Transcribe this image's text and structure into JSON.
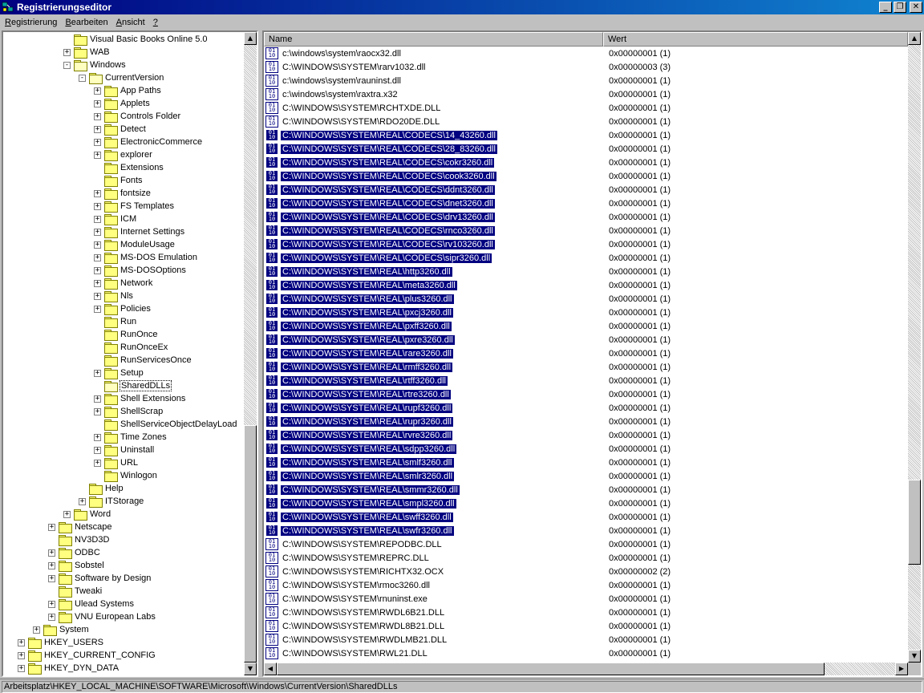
{
  "window": {
    "title": "Registrierungseditor",
    "minimize": "_",
    "maximize": "❐",
    "close": "✕",
    "app_icon": "registry-editor-icon"
  },
  "menu": [
    {
      "label": "Registrierung",
      "accel": "R"
    },
    {
      "label": "Bearbeiten",
      "accel": "B"
    },
    {
      "label": "Ansicht",
      "accel": "A"
    },
    {
      "label": "?",
      "accel": "?"
    }
  ],
  "tree": [
    {
      "label": "Visual Basic Books Online 5.0",
      "depth": 4,
      "expander": "",
      "open": false
    },
    {
      "label": "WAB",
      "depth": 4,
      "expander": "+",
      "open": false
    },
    {
      "label": "Windows",
      "depth": 4,
      "expander": "-",
      "open": true
    },
    {
      "label": "CurrentVersion",
      "depth": 5,
      "expander": "-",
      "open": true
    },
    {
      "label": "App Paths",
      "depth": 6,
      "expander": "+",
      "open": false
    },
    {
      "label": "Applets",
      "depth": 6,
      "expander": "+",
      "open": false
    },
    {
      "label": "Controls Folder",
      "depth": 6,
      "expander": "+",
      "open": false
    },
    {
      "label": "Detect",
      "depth": 6,
      "expander": "+",
      "open": false
    },
    {
      "label": "ElectronicCommerce",
      "depth": 6,
      "expander": "+",
      "open": false
    },
    {
      "label": "explorer",
      "depth": 6,
      "expander": "+",
      "open": false
    },
    {
      "label": "Extensions",
      "depth": 6,
      "expander": "",
      "open": false
    },
    {
      "label": "Fonts",
      "depth": 6,
      "expander": "",
      "open": false
    },
    {
      "label": "fontsize",
      "depth": 6,
      "expander": "+",
      "open": false
    },
    {
      "label": "FS Templates",
      "depth": 6,
      "expander": "+",
      "open": false
    },
    {
      "label": "ICM",
      "depth": 6,
      "expander": "+",
      "open": false
    },
    {
      "label": "Internet Settings",
      "depth": 6,
      "expander": "+",
      "open": false
    },
    {
      "label": "ModuleUsage",
      "depth": 6,
      "expander": "+",
      "open": false
    },
    {
      "label": "MS-DOS Emulation",
      "depth": 6,
      "expander": "+",
      "open": false
    },
    {
      "label": "MS-DOSOptions",
      "depth": 6,
      "expander": "+",
      "open": false
    },
    {
      "label": "Network",
      "depth": 6,
      "expander": "+",
      "open": false
    },
    {
      "label": "Nls",
      "depth": 6,
      "expander": "+",
      "open": false
    },
    {
      "label": "Policies",
      "depth": 6,
      "expander": "+",
      "open": false
    },
    {
      "label": "Run",
      "depth": 6,
      "expander": "",
      "open": false
    },
    {
      "label": "RunOnce",
      "depth": 6,
      "expander": "",
      "open": false
    },
    {
      "label": "RunOnceEx",
      "depth": 6,
      "expander": "",
      "open": false
    },
    {
      "label": "RunServicesOnce",
      "depth": 6,
      "expander": "",
      "open": false
    },
    {
      "label": "Setup",
      "depth": 6,
      "expander": "+",
      "open": false
    },
    {
      "label": "SharedDLLs",
      "depth": 6,
      "expander": "",
      "open": true,
      "selected": true
    },
    {
      "label": "Shell Extensions",
      "depth": 6,
      "expander": "+",
      "open": false
    },
    {
      "label": "ShellScrap",
      "depth": 6,
      "expander": "+",
      "open": false
    },
    {
      "label": "ShellServiceObjectDelayLoad",
      "depth": 6,
      "expander": "",
      "open": false
    },
    {
      "label": "Time Zones",
      "depth": 6,
      "expander": "+",
      "open": false
    },
    {
      "label": "Uninstall",
      "depth": 6,
      "expander": "+",
      "open": false
    },
    {
      "label": "URL",
      "depth": 6,
      "expander": "+",
      "open": false
    },
    {
      "label": "Winlogon",
      "depth": 6,
      "expander": "",
      "open": false
    },
    {
      "label": "Help",
      "depth": 5,
      "expander": "",
      "open": false
    },
    {
      "label": "ITStorage",
      "depth": 5,
      "expander": "+",
      "open": false
    },
    {
      "label": "Word",
      "depth": 4,
      "expander": "+",
      "open": false
    },
    {
      "label": "Netscape",
      "depth": 3,
      "expander": "+",
      "open": false
    },
    {
      "label": "NV3D3D",
      "depth": 3,
      "expander": "",
      "open": false
    },
    {
      "label": "ODBC",
      "depth": 3,
      "expander": "+",
      "open": false
    },
    {
      "label": "Sobstel",
      "depth": 3,
      "expander": "+",
      "open": false
    },
    {
      "label": "Software by Design",
      "depth": 3,
      "expander": "+",
      "open": false
    },
    {
      "label": "Tweaki",
      "depth": 3,
      "expander": "",
      "open": false
    },
    {
      "label": "Ulead Systems",
      "depth": 3,
      "expander": "+",
      "open": false
    },
    {
      "label": "VNU European Labs",
      "depth": 3,
      "expander": "+",
      "open": false
    },
    {
      "label": "System",
      "depth": 2,
      "expander": "+",
      "open": false
    },
    {
      "label": "HKEY_USERS",
      "depth": 1,
      "expander": "+",
      "open": false
    },
    {
      "label": "HKEY_CURRENT_CONFIG",
      "depth": 1,
      "expander": "+",
      "open": false
    },
    {
      "label": "HKEY_DYN_DATA",
      "depth": 1,
      "expander": "+",
      "open": false
    }
  ],
  "list": {
    "columns": [
      "Name",
      "Wert"
    ],
    "rows": [
      {
        "name": "c:\\windows\\system\\raocx32.dll",
        "value": "0x00000001 (1)",
        "selected": false
      },
      {
        "name": "C:\\WINDOWS\\SYSTEM\\rarv1032.dll",
        "value": "0x00000003 (3)",
        "selected": false
      },
      {
        "name": "c:\\windows\\system\\rauninst.dll",
        "value": "0x00000001 (1)",
        "selected": false
      },
      {
        "name": "c:\\windows\\system\\raxtra.x32",
        "value": "0x00000001 (1)",
        "selected": false
      },
      {
        "name": "C:\\WINDOWS\\SYSTEM\\RCHTXDE.DLL",
        "value": "0x00000001 (1)",
        "selected": false
      },
      {
        "name": "C:\\WINDOWS\\SYSTEM\\RDO20DE.DLL",
        "value": "0x00000001 (1)",
        "selected": false
      },
      {
        "name": "C:\\WINDOWS\\SYSTEM\\REAL\\CODECS\\14_43260.dll",
        "value": "0x00000001 (1)",
        "selected": true
      },
      {
        "name": "C:\\WINDOWS\\SYSTEM\\REAL\\CODECS\\28_83260.dll",
        "value": "0x00000001 (1)",
        "selected": true
      },
      {
        "name": "C:\\WINDOWS\\SYSTEM\\REAL\\CODECS\\cokr3260.dll",
        "value": "0x00000001 (1)",
        "selected": true
      },
      {
        "name": "C:\\WINDOWS\\SYSTEM\\REAL\\CODECS\\cook3260.dll",
        "value": "0x00000001 (1)",
        "selected": true
      },
      {
        "name": "C:\\WINDOWS\\SYSTEM\\REAL\\CODECS\\ddnt3260.dll",
        "value": "0x00000001 (1)",
        "selected": true
      },
      {
        "name": "C:\\WINDOWS\\SYSTEM\\REAL\\CODECS\\dnet3260.dll",
        "value": "0x00000001 (1)",
        "selected": true
      },
      {
        "name": "C:\\WINDOWS\\SYSTEM\\REAL\\CODECS\\drv13260.dll",
        "value": "0x00000001 (1)",
        "selected": true
      },
      {
        "name": "C:\\WINDOWS\\SYSTEM\\REAL\\CODECS\\rnco3260.dll",
        "value": "0x00000001 (1)",
        "selected": true
      },
      {
        "name": "C:\\WINDOWS\\SYSTEM\\REAL\\CODECS\\rv103260.dll",
        "value": "0x00000001 (1)",
        "selected": true
      },
      {
        "name": "C:\\WINDOWS\\SYSTEM\\REAL\\CODECS\\sipr3260.dll",
        "value": "0x00000001 (1)",
        "selected": true
      },
      {
        "name": "C:\\WINDOWS\\SYSTEM\\REAL\\http3260.dll",
        "value": "0x00000001 (1)",
        "selected": true
      },
      {
        "name": "C:\\WINDOWS\\SYSTEM\\REAL\\meta3260.dll",
        "value": "0x00000001 (1)",
        "selected": true
      },
      {
        "name": "C:\\WINDOWS\\SYSTEM\\REAL\\plus3260.dll",
        "value": "0x00000001 (1)",
        "selected": true
      },
      {
        "name": "C:\\WINDOWS\\SYSTEM\\REAL\\pxcj3260.dll",
        "value": "0x00000001 (1)",
        "selected": true
      },
      {
        "name": "C:\\WINDOWS\\SYSTEM\\REAL\\pxff3260.dll",
        "value": "0x00000001 (1)",
        "selected": true
      },
      {
        "name": "C:\\WINDOWS\\SYSTEM\\REAL\\pxre3260.dll",
        "value": "0x00000001 (1)",
        "selected": true
      },
      {
        "name": "C:\\WINDOWS\\SYSTEM\\REAL\\rare3260.dll",
        "value": "0x00000001 (1)",
        "selected": true
      },
      {
        "name": "C:\\WINDOWS\\SYSTEM\\REAL\\rmff3260.dll",
        "value": "0x00000001 (1)",
        "selected": true
      },
      {
        "name": "C:\\WINDOWS\\SYSTEM\\REAL\\rtff3260.dll",
        "value": "0x00000001 (1)",
        "selected": true
      },
      {
        "name": "C:\\WINDOWS\\SYSTEM\\REAL\\rtre3260.dll",
        "value": "0x00000001 (1)",
        "selected": true
      },
      {
        "name": "C:\\WINDOWS\\SYSTEM\\REAL\\rupf3260.dll",
        "value": "0x00000001 (1)",
        "selected": true
      },
      {
        "name": "C:\\WINDOWS\\SYSTEM\\REAL\\rupr3260.dll",
        "value": "0x00000001 (1)",
        "selected": true
      },
      {
        "name": "C:\\WINDOWS\\SYSTEM\\REAL\\rvre3260.dll",
        "value": "0x00000001 (1)",
        "selected": true
      },
      {
        "name": "C:\\WINDOWS\\SYSTEM\\REAL\\sdpp3260.dll",
        "value": "0x00000001 (1)",
        "selected": true
      },
      {
        "name": "C:\\WINDOWS\\SYSTEM\\REAL\\smlf3260.dll",
        "value": "0x00000001 (1)",
        "selected": true
      },
      {
        "name": "C:\\WINDOWS\\SYSTEM\\REAL\\smlr3260.dll",
        "value": "0x00000001 (1)",
        "selected": true
      },
      {
        "name": "C:\\WINDOWS\\SYSTEM\\REAL\\smmr3260.dll",
        "value": "0x00000001 (1)",
        "selected": true
      },
      {
        "name": "C:\\WINDOWS\\SYSTEM\\REAL\\smpl3260.dll",
        "value": "0x00000001 (1)",
        "selected": true
      },
      {
        "name": "C:\\WINDOWS\\SYSTEM\\REAL\\swff3260.dll",
        "value": "0x00000001 (1)",
        "selected": true
      },
      {
        "name": "C:\\WINDOWS\\SYSTEM\\REAL\\swfr3260.dll",
        "value": "0x00000001 (1)",
        "selected": true
      },
      {
        "name": "C:\\WINDOWS\\SYSTEM\\REPODBC.DLL",
        "value": "0x00000001 (1)",
        "selected": false
      },
      {
        "name": "C:\\WINDOWS\\SYSTEM\\REPRC.DLL",
        "value": "0x00000001 (1)",
        "selected": false
      },
      {
        "name": "C:\\WINDOWS\\SYSTEM\\RICHTX32.OCX",
        "value": "0x00000002 (2)",
        "selected": false
      },
      {
        "name": "C:\\WINDOWS\\SYSTEM\\rmoc3260.dll",
        "value": "0x00000001 (1)",
        "selected": false
      },
      {
        "name": "C:\\WINDOWS\\SYSTEM\\rnuninst.exe",
        "value": "0x00000001 (1)",
        "selected": false
      },
      {
        "name": "C:\\WINDOWS\\SYSTEM\\RWDL6B21.DLL",
        "value": "0x00000001 (1)",
        "selected": false
      },
      {
        "name": "C:\\WINDOWS\\SYSTEM\\RWDL8B21.DLL",
        "value": "0x00000001 (1)",
        "selected": false
      },
      {
        "name": "C:\\WINDOWS\\SYSTEM\\RWDLMB21.DLL",
        "value": "0x00000001 (1)",
        "selected": false
      },
      {
        "name": "C:\\WINDOWS\\SYSTEM\\RWL21.DLL",
        "value": "0x00000001 (1)",
        "selected": false
      }
    ]
  },
  "status": {
    "path": "Arbeitsplatz\\HKEY_LOCAL_MACHINE\\SOFTWARE\\Microsoft\\Windows\\CurrentVersion\\SharedDLLs"
  },
  "colors": {
    "titlebar": "#000080",
    "selection": "#000080",
    "face": "#c0c0c0"
  }
}
